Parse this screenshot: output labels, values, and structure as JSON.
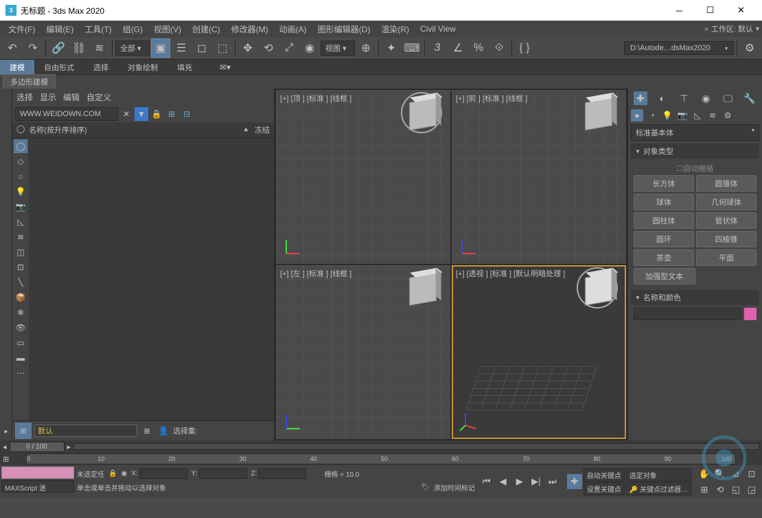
{
  "titlebar": {
    "app_icon": "3",
    "title": "无标题 - 3ds Max 2020"
  },
  "menubar": {
    "items": [
      "文件(F)",
      "编辑(E)",
      "工具(T)",
      "组(G)",
      "视图(V)",
      "创建(C)",
      "修改器(M)",
      "动画(A)",
      "图形编辑器(D)",
      "渲染(R)",
      "Civil View"
    ],
    "workspace_label": "工作区: 默认"
  },
  "toolbar": {
    "filter_dd": "全部",
    "refcoord_dd": "视图",
    "project_path": "D:\\Autode…dsMax2020"
  },
  "ribbon_tabs": {
    "tabs": [
      "建模",
      "自由形式",
      "选择",
      "对象绘制",
      "填充"
    ],
    "subtab": "多边形建模"
  },
  "scene_explorer": {
    "menus": [
      "选择",
      "显示",
      "编辑",
      "自定义"
    ],
    "search_value": "WWW.WEIDOWN.COM",
    "col_name": "名称(按升序排序)",
    "col_freeze": "冻结",
    "footer_input": "默认",
    "footer_label": "选择集:"
  },
  "viewports": {
    "top": "[+] [顶 ] [标准 ] [线框 ]",
    "front": "[+] [前 ] [标准 ] [线框 ]",
    "left": "[+] [左 ] [标准 ] [线框 ]",
    "persp": "[+] [透视 ] [标准 ] [默认明暗处理 ]"
  },
  "command_panel": {
    "category_dd": "标准基本体",
    "section_objtype": "对象类型",
    "autogrid": "自动栅格",
    "objects": [
      "长方体",
      "圆锥体",
      "球体",
      "几何球体",
      "圆柱体",
      "管状体",
      "圆环",
      "四棱锥",
      "茶壶",
      "平面",
      "加强型文本"
    ],
    "section_namecolor": "名称和颜色",
    "color": "#e060b0"
  },
  "timeline": {
    "slider": "0 / 100",
    "ticks": [
      "0",
      "10",
      "20",
      "30",
      "40",
      "50",
      "60",
      "70",
      "80",
      "90",
      "100"
    ]
  },
  "statusbar": {
    "script_label": "MAXScript 迷",
    "no_selection": "未选定任",
    "hint": "单击或单击并拖动以选择对象",
    "x": "X:",
    "y": "Y:",
    "z": "Z:",
    "grid": "栅格 = 10.0",
    "add_time": "添加时间标记",
    "autokey": "自动关键点",
    "setkey": "设置关键点",
    "selobj": "选定对象",
    "keyfilter": "关键点过滤器…"
  }
}
